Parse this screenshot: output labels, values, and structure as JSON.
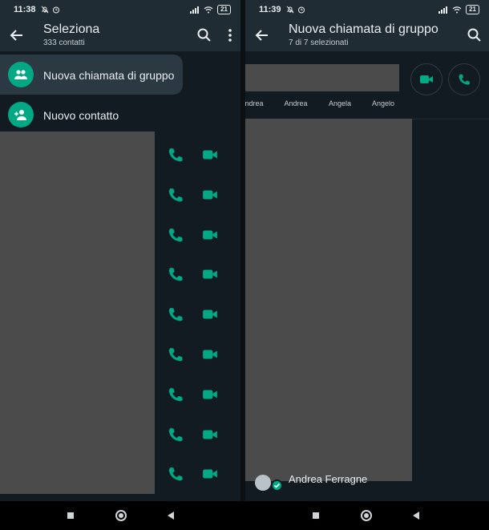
{
  "colors": {
    "accent": "#00a884",
    "appbar": "#1f2c34",
    "background": "#121b22",
    "redaction": "#4b4b4b"
  },
  "left_screen": {
    "status": {
      "time": "11:38",
      "battery": "21"
    },
    "header": {
      "title": "Seleziona",
      "subtitle": "333 contatti"
    },
    "icons": {
      "back": "arrow-left-icon",
      "search": "search-icon",
      "more": "more-vert-icon"
    },
    "actions": [
      {
        "label": "Nuova chiamata di gruppo",
        "icon": "group-icon"
      },
      {
        "label": "Nuovo contatto",
        "icon": "person-add-icon"
      }
    ],
    "contact_rows": 9
  },
  "right_screen": {
    "status": {
      "time": "11:39",
      "battery": "21"
    },
    "header": {
      "title": "Nuova chiamata di gruppo",
      "subtitle": "7 di 7 selezionati"
    },
    "selected": [
      "ndrea",
      "Andrea",
      "Angela",
      "Angelo"
    ],
    "last_contact": "Andrea Ferragne"
  }
}
